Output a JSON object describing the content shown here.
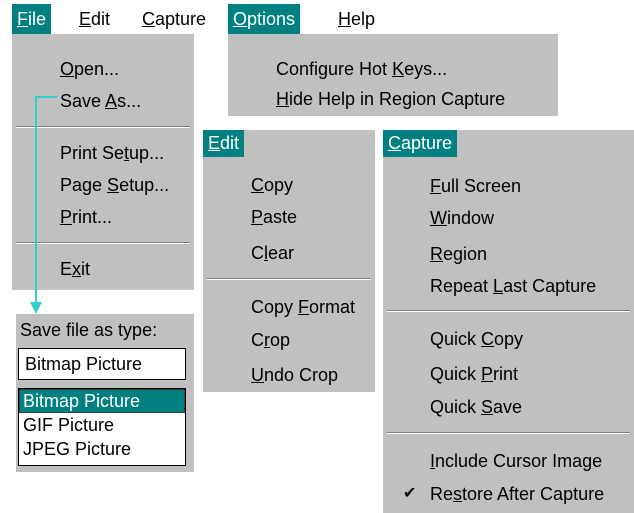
{
  "menubar": {
    "file": {
      "pre": "",
      "key": "F",
      "post": "ile"
    },
    "edit": {
      "pre": "",
      "key": "E",
      "post": "dit"
    },
    "capture": {
      "pre": "",
      "key": "C",
      "post": "apture"
    },
    "options": {
      "pre": "",
      "key": "O",
      "post": "ptions"
    },
    "help": {
      "pre": "",
      "key": "H",
      "post": "elp"
    }
  },
  "file_menu": {
    "open": {
      "pre": "",
      "key": "O",
      "post": "pen..."
    },
    "save_as": {
      "pre": "Save ",
      "key": "A",
      "post": "s..."
    },
    "print_setup": {
      "pre": "Print Se",
      "key": "t",
      "post": "up..."
    },
    "page_setup": {
      "pre": "Page ",
      "key": "S",
      "post": "etup..."
    },
    "print": {
      "pre": "",
      "key": "P",
      "post": "rint..."
    },
    "exit": {
      "pre": "E",
      "key": "x",
      "post": "it"
    }
  },
  "options_menu": {
    "configure_hot_keys": {
      "pre": "Configure Hot ",
      "key": "K",
      "post": "eys..."
    },
    "hide_help": {
      "pre": "",
      "key": "H",
      "post": "ide Help in Region Capture"
    }
  },
  "edit_menu": {
    "header": {
      "pre": "",
      "key": "E",
      "post": "dit"
    },
    "copy": {
      "pre": "",
      "key": "C",
      "post": "opy"
    },
    "paste": {
      "pre": "",
      "key": "P",
      "post": "aste"
    },
    "clear": {
      "pre": "C",
      "key": "l",
      "post": "ear"
    },
    "copy_format": {
      "pre": "Copy ",
      "key": "F",
      "post": "ormat"
    },
    "crop": {
      "pre": "C",
      "key": "r",
      "post": "op"
    },
    "undo_crop": {
      "pre": "",
      "key": "U",
      "post": "ndo Crop"
    }
  },
  "capture_menu": {
    "header": {
      "pre": "",
      "key": "C",
      "post": "apture"
    },
    "full_screen": {
      "pre": "",
      "key": "F",
      "post": "ull Screen"
    },
    "window": {
      "pre": "",
      "key": "W",
      "post": "indow"
    },
    "region": {
      "pre": "",
      "key": "R",
      "post": "egion"
    },
    "repeat_last": {
      "pre": "Repeat ",
      "key": "L",
      "post": "ast Capture"
    },
    "quick_copy": {
      "pre": "Quick ",
      "key": "C",
      "post": "opy"
    },
    "quick_print": {
      "pre": "Quick ",
      "key": "P",
      "post": "rint"
    },
    "quick_save": {
      "pre": "Quick ",
      "key": "S",
      "post": "ave"
    },
    "include_cursor": {
      "pre": "",
      "key": "I",
      "post": "nclude Cursor Image"
    },
    "restore_after": {
      "pre": "Re",
      "key": "s",
      "post": "tore After Capture"
    },
    "check_glyph": "✔"
  },
  "save_dialog": {
    "label": "Save file as type:",
    "field_value": "Bitmap Picture",
    "options": [
      "Bitmap Picture",
      "GIF Picture",
      "JPEG Picture"
    ]
  },
  "colors": {
    "menu_bg": "#c0c0c0",
    "highlight": "#008080",
    "arrow": "#33cccc"
  }
}
